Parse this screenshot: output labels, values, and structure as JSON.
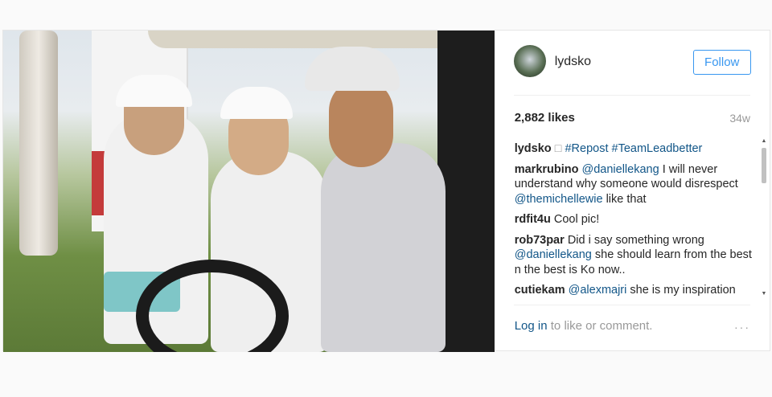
{
  "header": {
    "username": "lydsko",
    "follow_label": "Follow"
  },
  "stats": {
    "likes": "2,882 likes",
    "time": "34w"
  },
  "caption": {
    "user": "lydsko",
    "glyph": "□",
    "tags": [
      "#Repost",
      "#TeamLeadbetter"
    ]
  },
  "comments": [
    {
      "user": "markrubino",
      "mention": "@daniellekang",
      "text": " I will never understand why someone would disrespect ",
      "mention2": "@themichellewie",
      "text2": " like that"
    },
    {
      "user": "rdfit4u",
      "text": "Cool pic!"
    },
    {
      "user": "rob73par",
      "text": "Did i say something wrong ",
      "mention": "@daniellekang",
      "text2": " she should learn from the best n the best is Ko now.."
    },
    {
      "user": "cutiekam",
      "mention": "@alexmajri",
      "text": " she is my inspiration"
    }
  ],
  "footer": {
    "login_link": "Log in",
    "login_text": " to like or comment.",
    "more_icon": "···"
  }
}
